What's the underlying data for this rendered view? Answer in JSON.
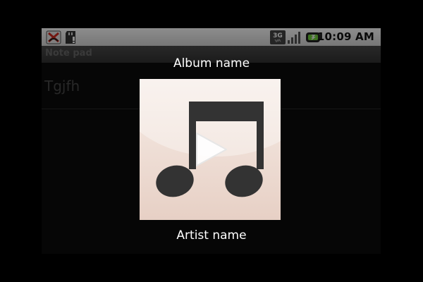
{
  "status_bar": {
    "time": "10:09 AM",
    "icons": [
      "missed-call-icon",
      "sd-card-icon",
      "3g-icon",
      "signal-icon",
      "battery-icon"
    ],
    "network_label": "3G"
  },
  "app": {
    "title": "Note pad"
  },
  "notes": {
    "items": [
      {
        "title": "Tgjfh"
      }
    ]
  },
  "media_overlay": {
    "album_name": "Album name",
    "artist_name": "Artist name",
    "art_icon": "music-note-icon",
    "play_icon": "play-icon"
  },
  "colors": {
    "background": "#000000",
    "status_bar": "#ffffff",
    "art_background": "#f0e0d8"
  }
}
